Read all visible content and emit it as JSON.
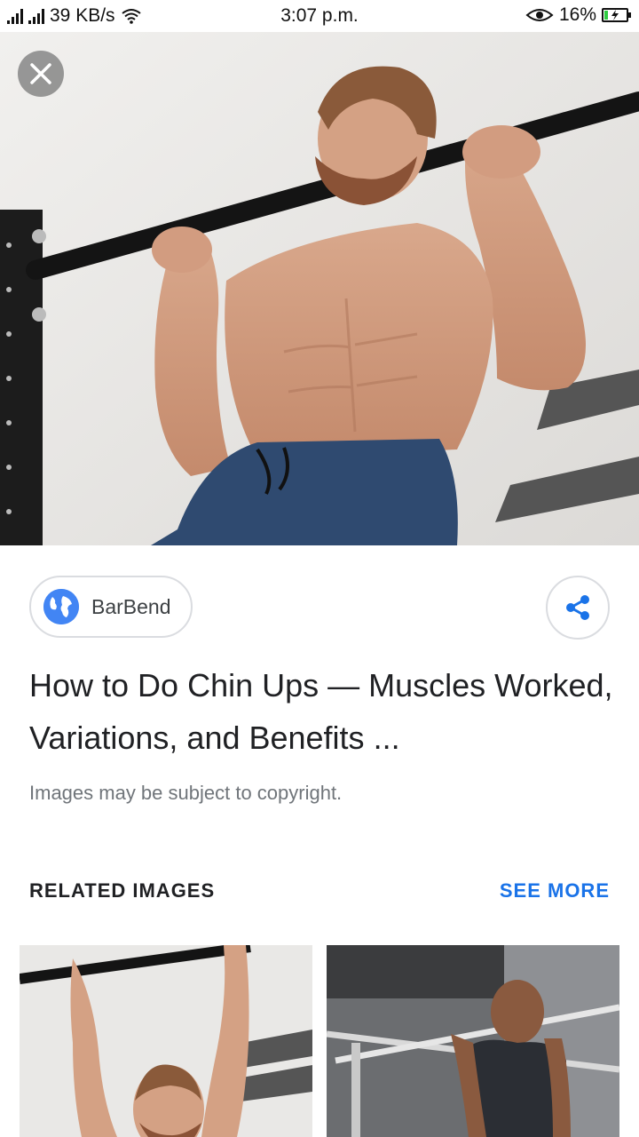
{
  "status_bar": {
    "network_speed": "39 KB/s",
    "time": "3:07 p.m.",
    "battery_percent": "16%",
    "battery_level": 0.16,
    "icons": [
      "signal-icon",
      "wifi-icon",
      "eye-icon",
      "battery-charging-icon"
    ]
  },
  "viewer": {
    "close_icon": "close-icon",
    "image_description_icon": "photo"
  },
  "source": {
    "name": "BarBend",
    "icon": "globe-icon"
  },
  "share": {
    "icon": "share-icon"
  },
  "title": "How to Do Chin Ups — Muscles Worked, Variations, and Benefits ...",
  "copyright_notice": "Images may be subject to copyright.",
  "related": {
    "heading": "RELATED IMAGES",
    "see_more": "SEE MORE"
  },
  "colors": {
    "accent": "#1a73e8",
    "globe": "#4285f4",
    "share": "#1a73e8"
  }
}
